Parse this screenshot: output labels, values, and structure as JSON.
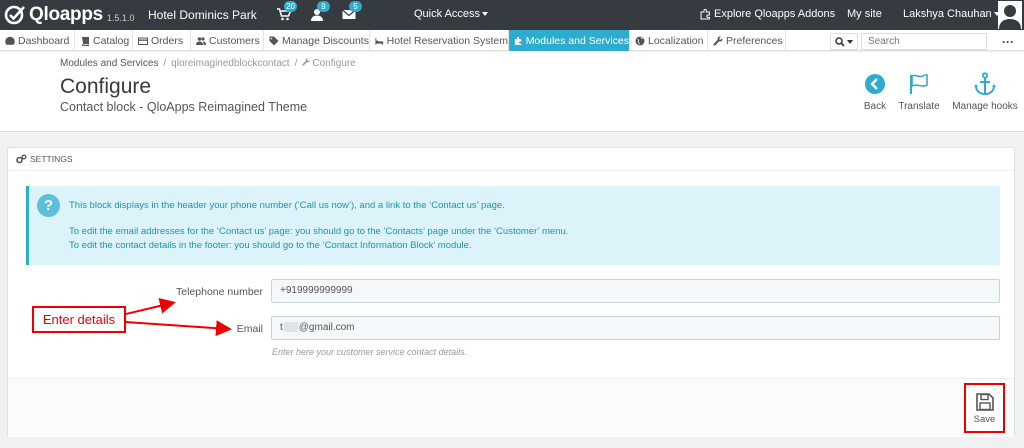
{
  "topbar": {
    "logo_text": "Qloapps",
    "version": "1.5.1.0",
    "shop_name": "Hotel Dominics Park",
    "notifications": {
      "orders": "20",
      "customers": "9",
      "messages": "5"
    },
    "quick_access": "Quick Access",
    "explore": "Explore Qloapps Addons",
    "my_site": "My site",
    "user": "Lakshya Chauhan"
  },
  "nav": {
    "items": [
      {
        "label": "Dashboard",
        "icon": "dashboard-icon"
      },
      {
        "label": "Catalog",
        "icon": "book-icon"
      },
      {
        "label": "Orders",
        "icon": "credit-card-icon"
      },
      {
        "label": "Customers",
        "icon": "users-icon"
      },
      {
        "label": "Manage Discounts",
        "icon": "tag-icon"
      },
      {
        "label": "Hotel Reservation System",
        "icon": "bed-icon"
      },
      {
        "label": "Modules and Services",
        "icon": "puzzle-icon",
        "active": true
      },
      {
        "label": "Localization",
        "icon": "globe-icon"
      },
      {
        "label": "Preferences",
        "icon": "wrench-icon"
      }
    ],
    "search_placeholder": "Search",
    "search_toggle": "Q"
  },
  "breadcrumb": {
    "root": "Modules and Services",
    "module": "qloreimaginedblockcontact",
    "current": "Configure"
  },
  "page": {
    "title": "Configure",
    "subtitle": "Contact block - QloApps Reimagined Theme"
  },
  "toolbar": {
    "back": "Back",
    "translate": "Translate",
    "manage_hooks": "Manage hooks"
  },
  "panel": {
    "heading": "SETTINGS",
    "info_line1": "This block displays in the header your phone number (‘Call us now’), and a link to the ‘Contact us’ page.",
    "info_line2": "To edit the email addresses for the ‘Contact us’ page: you should go to the ‘Contacts’ page under the ‘Customer’ menu.",
    "info_line3": "To edit the contact details in the footer: you should go to the ‘Contact Information Block’ module.",
    "telephone_label": "Telephone number",
    "telephone_value": "+919999999999",
    "email_label": "Email",
    "email_prefix": "t",
    "email_suffix": "@gmail.com",
    "email_help": "Enter here your customer service contact details.",
    "save": "Save"
  },
  "annotation": {
    "label": "Enter details",
    "color": "#ee0000"
  },
  "colors": {
    "topbar": "#363a41",
    "accent": "#2eacce",
    "info_bg": "#dcf4f9"
  }
}
